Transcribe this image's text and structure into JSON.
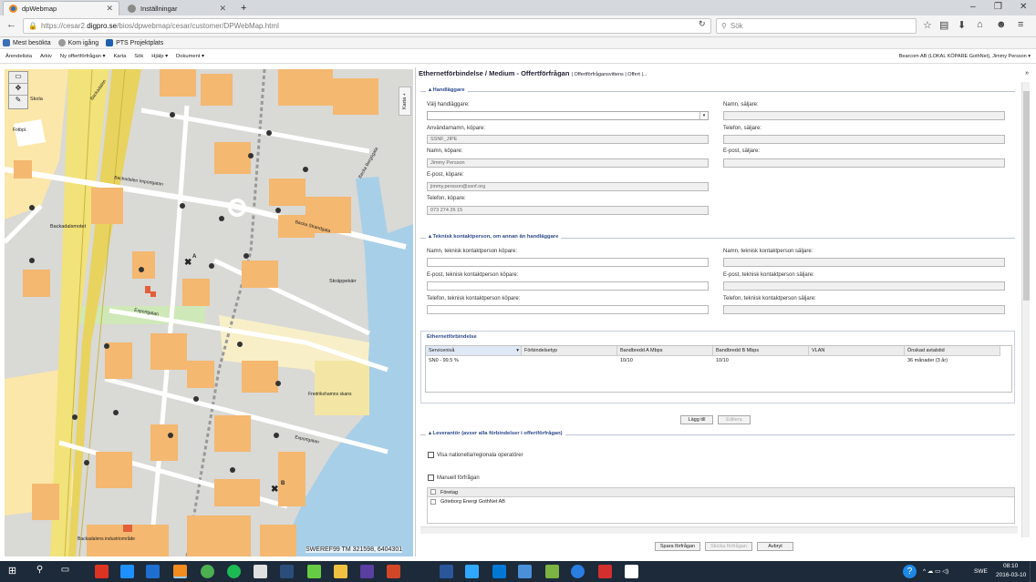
{
  "browser": {
    "tabs": [
      {
        "label": "dpWebmap",
        "active": true
      },
      {
        "label": "Inställningar",
        "active": false
      }
    ],
    "url_prefix": "https://cesar2.",
    "url_domain": "digpro.se",
    "url_path": "/bios/dpwebmap/cesar/customer/DPWebMap.html",
    "search_placeholder": "Sök",
    "bookmarks": [
      "Mest besökta",
      "Kom igång",
      "PTS Projektplats"
    ]
  },
  "app_menu": {
    "items": [
      "Ärendelista",
      "Arkiv",
      "Ny offertförfrågan ▾",
      "Karta",
      "Sök",
      "Hjälp ▾",
      "Dokument ▾"
    ],
    "user": "Bearcom AB (LOKAL KÖPARE GothNet), Jimmy Persson ▾"
  },
  "map": {
    "side_tab": "Karta +",
    "coordinate_readout": "SWEREF99 TM 321598, 6404301",
    "labels": [
      "Skola",
      "Fotbpl.",
      "Backadalen",
      "Backadalsmotet",
      "Backa Strandgata",
      "Backa Bergögata",
      "Backadalen Importgatan",
      "Skräppekärr",
      "Exportgatan",
      "Fredrikshamns skans",
      "Exportgatan",
      "Backadalens industriområde",
      "A",
      "B"
    ]
  },
  "panel": {
    "title": "Ethernetförbindelse / Medium - Offertförfrågan",
    "subtitle": "| Offertförfrågansvittens | Offert |...",
    "sections": {
      "handlaggare": {
        "legend": "Handläggare",
        "fields_left": [
          {
            "label": "Välj handläggare:",
            "value": ""
          },
          {
            "label": "Användarnamn, köpare:",
            "value": "SSNF_JIPE"
          },
          {
            "label": "Namn, köpare:",
            "value": "Jimmy Persson"
          },
          {
            "label": "E-post, köpare:",
            "value": "jimmy.persson@ssnf.org"
          },
          {
            "label": "Telefon, köpare:",
            "value": "073 274 26 15"
          }
        ],
        "fields_right": [
          {
            "label": "Namn, säljare:",
            "value": ""
          },
          {
            "label": "Telefon, säljare:",
            "value": ""
          },
          {
            "label": "E-post, säljare:",
            "value": ""
          }
        ]
      },
      "teknisk": {
        "legend": "Teknisk kontaktperson, om annan än handläggare",
        "fields_left": [
          {
            "label": "Namn, teknisk kontaktperson köpare:",
            "value": ""
          },
          {
            "label": "E-post, teknisk kontaktperson köpare:",
            "value": ""
          },
          {
            "label": "Telefon, teknisk kontaktperson köpare:",
            "value": ""
          }
        ],
        "fields_right": [
          {
            "label": "Namn, teknisk kontaktperson säljare:",
            "value": ""
          },
          {
            "label": "E-post, teknisk kontaktperson säljare:",
            "value": ""
          },
          {
            "label": "Telefon, teknisk kontaktperson säljare:",
            "value": ""
          }
        ]
      },
      "ethernet": {
        "legend": "Ethernetförbindelse",
        "columns": [
          "Servicenivå",
          "Förbindelsetyp",
          "Bandbredd A Mbps",
          "Bandbredd B Mbps",
          "VLAN",
          "Önskad avtalstid"
        ],
        "rows": [
          [
            "SN0 - 99.5 %",
            "",
            "10/10",
            "10/10",
            "",
            "36 månader (3 år)"
          ]
        ],
        "btn_add": "Lägg till",
        "btn_edit": "Editera"
      },
      "leverantor": {
        "legend": "Leverantör (avser alla förbindelser i offertförfrågan)",
        "check_national": "Visa nationella/regionala operatörer",
        "check_manual": "Manuell förfrågan",
        "list_header": "Företag",
        "list_items": [
          "Göteborg Energi GothNet AB"
        ]
      }
    },
    "buttons": {
      "save": "Spara förfrågan",
      "send": "Skicka förfrågan",
      "cancel": "Avbryt"
    }
  },
  "taskbar": {
    "language": "SWE",
    "time": "08:10",
    "date": "2016-03-10"
  }
}
